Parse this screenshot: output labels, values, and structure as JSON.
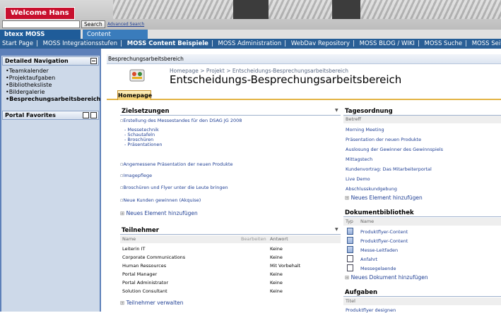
{
  "header": {
    "welcome": "Welcome Hans Moss",
    "search_button": "Search",
    "advanced_search": "Advanced Search",
    "search_value": ""
  },
  "tabs": {
    "site": "btexx MOSS Integration",
    "admin": "Content Administration"
  },
  "nav": [
    "Start Page",
    "MOSS Integrationsstufen",
    "MOSS Content Beispiele",
    "MOSS Administration",
    "WebDav Repository",
    "MOSS BLOG / WIKI",
    "MOSS Suche",
    "MOSS Seiten Strukturen"
  ],
  "left": {
    "detailed_nav": "Detailed Navigation",
    "items": [
      "Teamkalender",
      "Projektaufgaben",
      "Bibliotheksliste",
      "Bildergalerie",
      "Besprechungsarbeitsbereich"
    ],
    "portal_favorites": "Portal Favorites"
  },
  "page": {
    "crumb_bar": "Besprechungsarbeitsbereich",
    "breadcrumb": "Homepage > Projekt > Entscheidungs-Besprechungsarbeitsbereich",
    "title": "Entscheidungs-Besprechungsarbeitsbereich",
    "tab": "Homepage"
  },
  "ziele": {
    "title": "Zielsetzungen",
    "item1": "Erstellung des Messestandes für den DSAG JG 2008",
    "sub": [
      "- Messetechnik",
      "- Schautafeln",
      "- Broschüren",
      "- Präsentationen"
    ],
    "items": [
      "Angemessene Präsentation der neuen Produkte",
      "Imagepflege",
      "Broschüren und Flyer unter die Leute bringen",
      "Neue Kunden gewinnen (Akquise)"
    ],
    "add": "Neues Element hinzufügen"
  },
  "teilnehmer": {
    "title": "Teilnehmer",
    "col_name": "Name",
    "col_bearbeiten": "Bearbeiten",
    "col_antwort": "Antwort",
    "rows": [
      {
        "name": "Leiterin IT",
        "antwort": "Keine"
      },
      {
        "name": "Corporate Communications",
        "antwort": "Keine"
      },
      {
        "name": "Human Ressources",
        "antwort": "Mit Vorbehalt"
      },
      {
        "name": "Portal Manager",
        "antwort": "Keine"
      },
      {
        "name": "Portal Administrator",
        "antwort": "Keine"
      },
      {
        "name": "Solution Consultant",
        "antwort": "Keine"
      }
    ],
    "manage": "Teilnehmer verwalten"
  },
  "tagesordnung": {
    "title": "Tagesordnung",
    "col": "Betreff",
    "items": [
      "Morning Meeting",
      "Präsentation der neuen Produkte",
      "Auslosung der Gewinner des Gewinnspiels",
      "Mittagstech",
      "Kundenvortrag: Das Mitarbeiterportal",
      "Live Demo",
      "Abschlusskundgebung"
    ],
    "add": "Neues Element hinzufügen"
  },
  "dokumente": {
    "title": "Dokumentbibliothek",
    "col_type": "Typ",
    "col_name": "Name",
    "items": [
      "Produktflyer-Content",
      "Produktflyer-Content",
      "Messe-Leitfaden",
      "Anfahrt",
      "Messegelaende"
    ],
    "add": "Neues Dokument hinzufügen"
  },
  "aufgaben": {
    "title": "Aufgaben",
    "col": "Titel",
    "items": [
      "Produktflyer designen"
    ]
  }
}
